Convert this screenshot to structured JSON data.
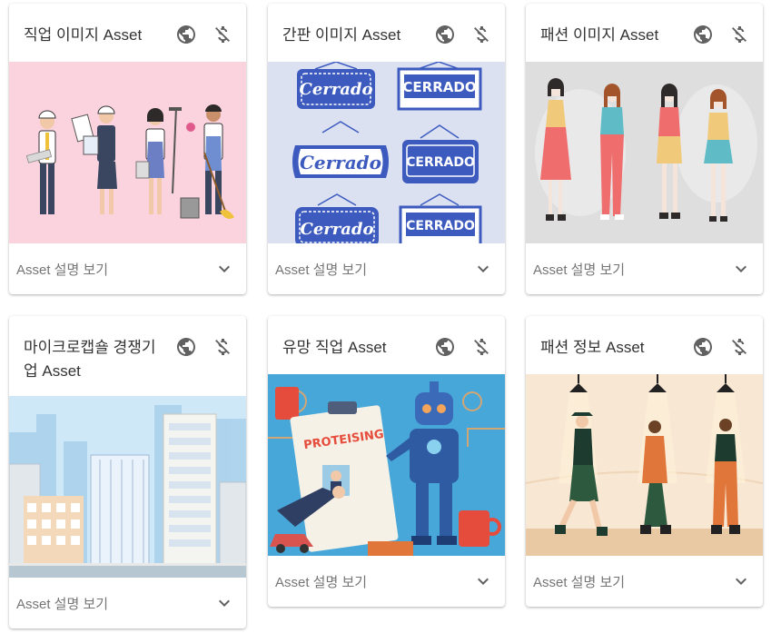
{
  "cards": [
    {
      "title": "직업 이미지 Asset",
      "footer": "Asset 설명 보기"
    },
    {
      "title": "간판 이미지 Asset",
      "footer": "Asset 설명 보기"
    },
    {
      "title": "패션 이미지 Asset",
      "footer": "Asset 설명 보기"
    },
    {
      "title": "마이크로캡숄 경쟁기업 Asset",
      "footer": "Asset 설명 보기"
    },
    {
      "title": "유망 직업 Asset",
      "footer": "Asset 설명 보기"
    },
    {
      "title": "패션 정보 Asset",
      "footer": "Asset 설명 보기"
    }
  ],
  "icons": {
    "globe": "globe-icon",
    "no_price": "money-off-icon",
    "expand": "chevron-down-icon"
  },
  "colors": {
    "card1_bg": "#fbd3df",
    "card2_bg": "#dce1f2",
    "card3_bg": "#dedede",
    "card4_bg": "#cfe8f8",
    "card5_bg": "#47a7d9",
    "card6_bg": "#f7e7d3",
    "sign_blue": "#3d5bbf"
  },
  "sign_text": {
    "cerrado_script": "Cerrado",
    "cerrado_caps": "CERRADO"
  },
  "poster_text": "PROTEISING"
}
